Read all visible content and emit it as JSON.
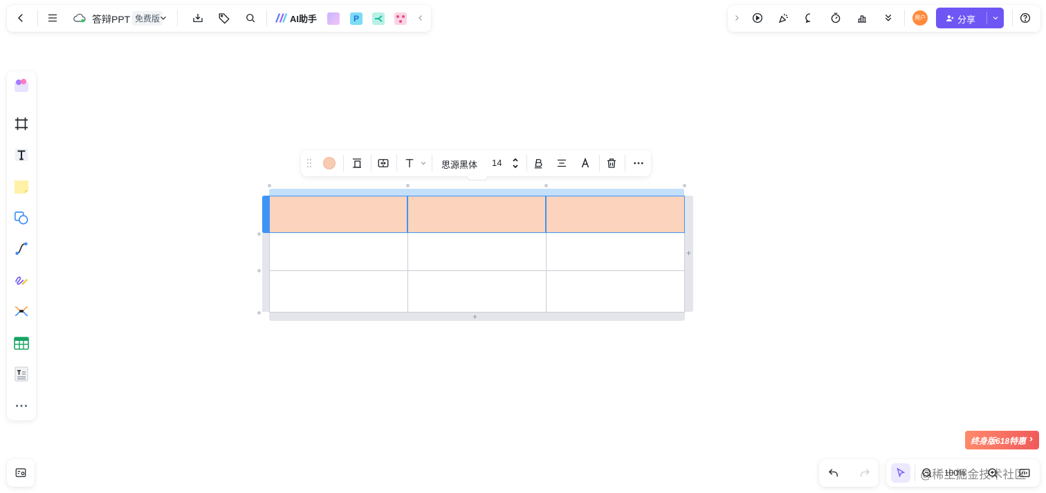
{
  "header": {
    "doc_title": "答辩PPT",
    "plan_badge": "免费版",
    "ai_label": "AI助手",
    "avatar_text": "用户",
    "share_label": "分享"
  },
  "format_toolbar": {
    "font_family": "思源黑体",
    "font_size": "14",
    "fill_color": "#f9cbb0"
  },
  "table": {
    "header_fill": "#fcd3bd",
    "rows": 3,
    "cols": 3
  },
  "promo": {
    "label": "终身版618特惠",
    "arrow": "›"
  },
  "bottom_right": {
    "zoom": "100%",
    "watermark": "@稀土掘金技术社区"
  },
  "colors": {
    "accent": "#6e56f5",
    "selection": "#3d94f6",
    "avatar": "#ff8a3d",
    "promo": "#f05a5a"
  }
}
